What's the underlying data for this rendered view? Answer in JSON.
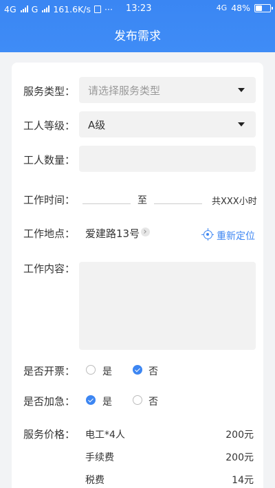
{
  "status_bar": {
    "network1": "4G",
    "network2": "G",
    "speed": "161.6K/s",
    "misc_icon": "sim-icon",
    "dots": "···",
    "time": "13:23",
    "network3": "4G",
    "battery": "48%",
    "battery_level": 0.48
  },
  "header": {
    "title": "发布需求"
  },
  "form": {
    "service_type": {
      "label": "服务类型：",
      "placeholder": "请选择服务类型"
    },
    "worker_level": {
      "label": "工人等级：",
      "value": "A级"
    },
    "worker_count": {
      "label": "工人数量：",
      "value": ""
    },
    "work_time": {
      "label": "工作时间：",
      "to": "至",
      "total": "共XXX小时"
    },
    "work_location": {
      "label": "工作地点：",
      "value": "爱建路13号",
      "relocate": "重新定位"
    },
    "work_content": {
      "label": "工作内容：",
      "value": ""
    },
    "invoice": {
      "label": "是否开票：",
      "yes": "是",
      "no": "否",
      "selected": "no"
    },
    "urgent": {
      "label": "是否加急：",
      "yes": "是",
      "no": "否",
      "selected": "yes"
    },
    "price": {
      "label": "服务价格：",
      "items": [
        {
          "name": "电工*4人",
          "amount": "200元"
        },
        {
          "name": "手续费",
          "amount": "200元"
        },
        {
          "name": "税费",
          "amount": "14元"
        }
      ]
    }
  },
  "colors": {
    "primary": "#3d86f2"
  }
}
